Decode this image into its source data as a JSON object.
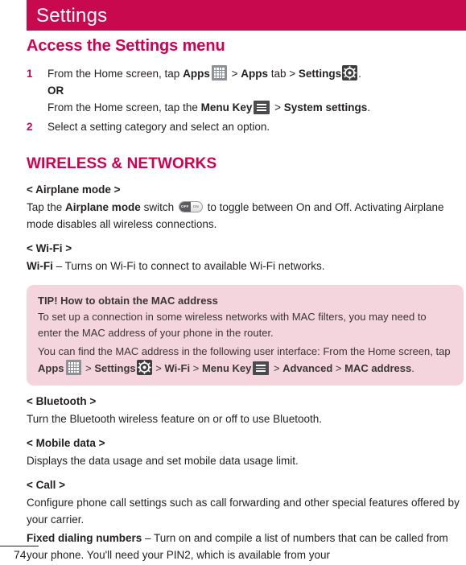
{
  "header": {
    "title": "Settings",
    "bar_color": "#c8094e"
  },
  "section": {
    "title": "Access the Settings menu",
    "title_color": "#d1004f"
  },
  "steps": [
    {
      "num": "1",
      "line1_pre": "From the Home screen, tap ",
      "line1_bold1": "Apps",
      "icon1": "apps-grid-icon",
      "line1_mid1": " > ",
      "line1_bold2": "Apps",
      "line1_mid2": " tab > ",
      "line1_bold3": "Settings",
      "icon2": "gear-icon",
      "line1_end": ".",
      "line2": "OR",
      "line3_pre": "From the Home screen, tap the ",
      "line3_bold1": "Menu Key",
      "icon3": "menu-key-icon",
      "line3_mid": " > ",
      "line3_bold2": "System settings",
      "line3_end": "."
    },
    {
      "num": "2",
      "text": "Select a setting category and select an option."
    }
  ],
  "group": {
    "title": "WIRELESS & NETWORKS",
    "title_color": "#d1004f"
  },
  "airplane": {
    "heading": "< Airplane mode >",
    "body_pre": "Tap the ",
    "body_bold": "Airplane mode",
    "body_mid": " switch ",
    "toggle_off_label": "OFF",
    "toggle_on_label": "ON",
    "body_post": " to toggle between On and Off. Activating Airplane mode disables all wireless connections."
  },
  "wifi": {
    "heading": "< Wi-Fi >",
    "body_bold": "Wi-Fi",
    "body_rest": " – Turns on Wi-Fi to connect to available Wi-Fi networks."
  },
  "tip": {
    "background": "#f5d5dd",
    "title": "TIP! How to obtain the MAC address",
    "para1": "To set up a connection in some wireless networks with MAC filters, you may need to enter the MAC address of your phone in the router.",
    "para2_pre": "You can find the MAC address in the following user interface: From the Home screen, tap ",
    "para2_bold1": "Apps",
    "icon1": "apps-grid-icon",
    "para2_mid1": " > ",
    "para2_bold2": "Settings",
    "icon2": "gear-icon",
    "para2_mid2": " > ",
    "para2_bold3": "Wi-Fi",
    "para2_mid3": " > ",
    "para2_bold4": "Menu Key",
    "icon3": "menu-key-icon",
    "para2_mid4": " > ",
    "para2_bold5": "Advanced",
    "para2_mid5": " > ",
    "para2_bold6": "MAC address",
    "para2_end": "."
  },
  "bluetooth": {
    "heading": "< Bluetooth >",
    "body": "Turn the Bluetooth wireless feature on or off to use Bluetooth."
  },
  "mobile_data": {
    "heading": "< Mobile data >",
    "body": "Displays the data usage and set mobile data usage limit."
  },
  "call": {
    "heading": "< Call >",
    "body": "Configure phone call settings such as call forwarding and other special features offered by your carrier.",
    "fdn_bold": "Fixed dialing numbers",
    "fdn_rest": " – Turn on and compile a list of numbers that can be called from your phone. You'll need your PIN2, which is available from your"
  },
  "footer": {
    "page_number": "74"
  }
}
